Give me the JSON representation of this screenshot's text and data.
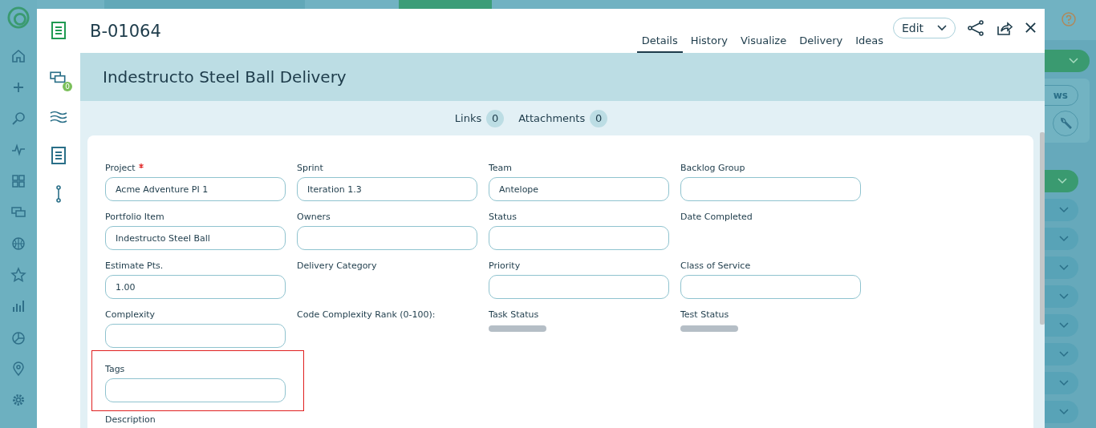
{
  "background": {
    "partial_button": "ws"
  },
  "item": {
    "id": "B-01064",
    "title": "Indestructo Steel Ball Delivery"
  },
  "side_tabs": [
    {
      "kind": "details",
      "selected": true
    },
    {
      "kind": "comments",
      "selected": false,
      "badge": "0"
    },
    {
      "kind": "waves",
      "selected": false
    },
    {
      "kind": "document",
      "selected": false
    },
    {
      "kind": "links",
      "selected": false
    }
  ],
  "tabs": [
    {
      "label": "Details",
      "selected": true
    },
    {
      "label": "History",
      "selected": false
    },
    {
      "label": "Visualize",
      "selected": false
    },
    {
      "label": "Delivery",
      "selected": false
    },
    {
      "label": "Ideas",
      "selected": false
    }
  ],
  "edit_button": {
    "label": "Edit"
  },
  "counters": [
    {
      "label": "Links",
      "count": "0"
    },
    {
      "label": "Attachments",
      "count": "0"
    }
  ],
  "fields": [
    {
      "label": "Project",
      "kind": "input",
      "required": true,
      "value": "Acme Adventure PI 1",
      "highlighted": false
    },
    {
      "label": "Sprint",
      "kind": "input",
      "required": false,
      "value": "Iteration 1.3",
      "highlighted": false
    },
    {
      "label": "Team",
      "kind": "input",
      "required": false,
      "value": "Antelope",
      "highlighted": false
    },
    {
      "label": "Backlog Group",
      "kind": "input",
      "required": false,
      "highlighted": false
    },
    {
      "label": "Portfolio Item",
      "kind": "input",
      "required": false,
      "value": "Indestructo Steel Ball",
      "highlighted": false
    },
    {
      "label": "Owners",
      "kind": "input",
      "required": false,
      "highlighted": false
    },
    {
      "label": "Status",
      "kind": "input",
      "required": false,
      "highlighted": false
    },
    {
      "label": "Date Completed",
      "kind": "text",
      "required": false,
      "highlighted": false
    },
    {
      "label": "Estimate Pts.",
      "kind": "input",
      "required": false,
      "value": "1.00",
      "highlighted": false
    },
    {
      "label": "Delivery Category",
      "kind": "text",
      "required": false,
      "highlighted": false
    },
    {
      "label": "Priority",
      "kind": "input",
      "required": false,
      "highlighted": false
    },
    {
      "label": "Class of Service",
      "kind": "input",
      "required": false,
      "highlighted": false
    },
    {
      "label": "Complexity",
      "kind": "input",
      "required": false,
      "highlighted": false
    },
    {
      "label": "Code Complexity Rank (0-100):",
      "kind": "text",
      "required": false,
      "highlighted": false
    },
    {
      "label": "Task Status",
      "kind": "loading",
      "required": false,
      "highlighted": false
    },
    {
      "label": "Test Status",
      "kind": "loading",
      "required": false,
      "highlighted": false
    },
    {
      "label": "Tags",
      "kind": "input",
      "required": false,
      "highlighted": true
    }
  ],
  "next_section_label": "Description"
}
